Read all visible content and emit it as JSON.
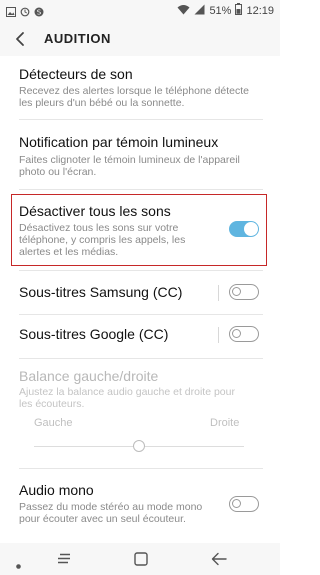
{
  "status_bar": {
    "battery": "51%",
    "time": "12:19",
    "icons": [
      "gallery-icon",
      "sync-icon",
      "samsung-icon",
      "wifi-icon",
      "signal-icon",
      "battery-icon"
    ]
  },
  "header": {
    "title": "AUDITION",
    "back_icon": "chevron-left-icon"
  },
  "settings": {
    "sound_detectors": {
      "title": "Détecteurs de son",
      "subtitle": "Recevez des alertes lorsque le téléphone détecte les pleurs d'un bébé ou la sonnette."
    },
    "flash_notification": {
      "title": "Notification par témoin lumineux",
      "subtitle": "Faites clignoter le témoin lumineux de l'appareil photo ou l'écran."
    },
    "mute_all": {
      "title": "Désactiver tous les sons",
      "subtitle": "Désactivez tous les sons sur votre téléphone, y compris les appels, les alertes et les médias.",
      "enabled": true
    },
    "samsung_subtitles": {
      "title": "Sous-titres Samsung (CC)",
      "enabled": false
    },
    "google_subtitles": {
      "title": "Sous-titres Google (CC)",
      "enabled": false
    },
    "balance": {
      "title": "Balance gauche/droite",
      "subtitle": "Ajustez la balance audio gauche et droite pour les écouteurs.",
      "left_label": "Gauche",
      "right_label": "Droite",
      "value": 0.5
    },
    "mono_audio": {
      "title": "Audio mono",
      "subtitle": "Passez du mode stéréo au mode mono pour écouter avec un seul écouteur.",
      "enabled": false
    }
  },
  "colors": {
    "accent": "#5fb5e0",
    "highlight": "#c62828",
    "background": "#ffffff",
    "bar": "#f7f7f7"
  },
  "nav_bar": {
    "icons": [
      "dot-icon",
      "recent-apps-icon",
      "home-icon",
      "back-icon"
    ]
  }
}
